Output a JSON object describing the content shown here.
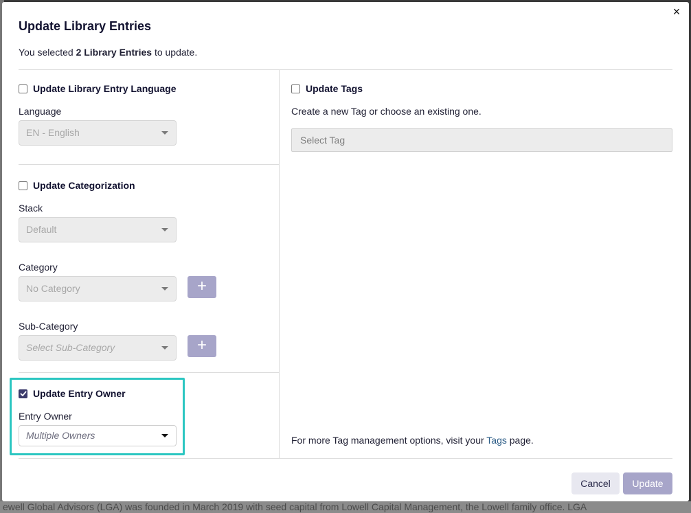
{
  "background": {
    "text": "ewell Global Advisors (LGA) was founded in March 2019 with seed capital from Lowell Capital Management, the Lowell family office. LGA"
  },
  "modal": {
    "title": "Update Library Entries",
    "subtitle_prefix": "You selected ",
    "subtitle_bold": "2 Library Entries",
    "subtitle_suffix": " to update.",
    "close_icon": "×"
  },
  "language_section": {
    "checkbox_label": "Update Library Entry Language",
    "checked": false,
    "field_label": "Language",
    "select_value": "EN - English"
  },
  "categorization_section": {
    "checkbox_label": "Update Categorization",
    "checked": false,
    "stack_label": "Stack",
    "stack_value": "Default",
    "category_label": "Category",
    "category_value": "No Category",
    "subcategory_label": "Sub-Category",
    "subcategory_placeholder": "Select Sub-Category",
    "add_button": "+"
  },
  "owner_section": {
    "checkbox_label": "Update Entry Owner",
    "checked": true,
    "field_label": "Entry Owner",
    "select_placeholder": "Multiple Owners"
  },
  "tags_section": {
    "checkbox_label": "Update Tags",
    "checked": false,
    "description": "Create a new Tag or choose an existing one.",
    "select_placeholder": "Select Tag",
    "note_prefix": "For more Tag management options, visit your ",
    "note_link": "Tags",
    "note_suffix": " page."
  },
  "footer": {
    "cancel_label": "Cancel",
    "update_label": "Update"
  },
  "colors": {
    "accent": "#3b3a6b",
    "button_disabled": "#a7a5c9",
    "highlight": "#2bc6c1",
    "link": "#2a5b86"
  }
}
